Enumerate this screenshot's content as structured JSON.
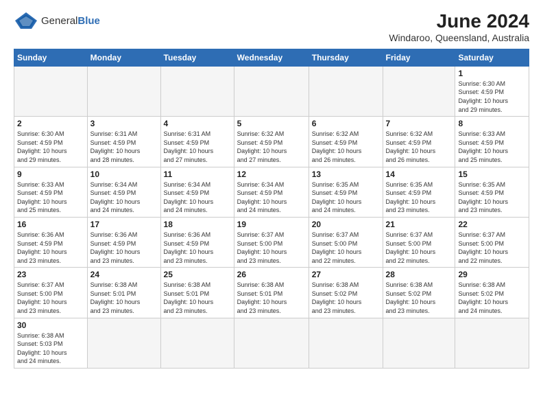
{
  "logo": {
    "text_general": "General",
    "text_blue": "Blue"
  },
  "title": "June 2024",
  "location": "Windaroo, Queensland, Australia",
  "weekdays": [
    "Sunday",
    "Monday",
    "Tuesday",
    "Wednesday",
    "Thursday",
    "Friday",
    "Saturday"
  ],
  "weeks": [
    [
      {
        "day": "",
        "info": ""
      },
      {
        "day": "",
        "info": ""
      },
      {
        "day": "",
        "info": ""
      },
      {
        "day": "",
        "info": ""
      },
      {
        "day": "",
        "info": ""
      },
      {
        "day": "",
        "info": ""
      },
      {
        "day": "1",
        "info": "Sunrise: 6:30 AM\nSunset: 4:59 PM\nDaylight: 10 hours\nand 29 minutes."
      }
    ],
    [
      {
        "day": "2",
        "info": "Sunrise: 6:30 AM\nSunset: 4:59 PM\nDaylight: 10 hours\nand 29 minutes."
      },
      {
        "day": "3",
        "info": "Sunrise: 6:31 AM\nSunset: 4:59 PM\nDaylight: 10 hours\nand 28 minutes."
      },
      {
        "day": "4",
        "info": "Sunrise: 6:31 AM\nSunset: 4:59 PM\nDaylight: 10 hours\nand 27 minutes."
      },
      {
        "day": "5",
        "info": "Sunrise: 6:32 AM\nSunset: 4:59 PM\nDaylight: 10 hours\nand 27 minutes."
      },
      {
        "day": "6",
        "info": "Sunrise: 6:32 AM\nSunset: 4:59 PM\nDaylight: 10 hours\nand 26 minutes."
      },
      {
        "day": "7",
        "info": "Sunrise: 6:32 AM\nSunset: 4:59 PM\nDaylight: 10 hours\nand 26 minutes."
      },
      {
        "day": "8",
        "info": "Sunrise: 6:33 AM\nSunset: 4:59 PM\nDaylight: 10 hours\nand 25 minutes."
      }
    ],
    [
      {
        "day": "9",
        "info": "Sunrise: 6:33 AM\nSunset: 4:59 PM\nDaylight: 10 hours\nand 25 minutes."
      },
      {
        "day": "10",
        "info": "Sunrise: 6:34 AM\nSunset: 4:59 PM\nDaylight: 10 hours\nand 24 minutes."
      },
      {
        "day": "11",
        "info": "Sunrise: 6:34 AM\nSunset: 4:59 PM\nDaylight: 10 hours\nand 24 minutes."
      },
      {
        "day": "12",
        "info": "Sunrise: 6:34 AM\nSunset: 4:59 PM\nDaylight: 10 hours\nand 24 minutes."
      },
      {
        "day": "13",
        "info": "Sunrise: 6:35 AM\nSunset: 4:59 PM\nDaylight: 10 hours\nand 24 minutes."
      },
      {
        "day": "14",
        "info": "Sunrise: 6:35 AM\nSunset: 4:59 PM\nDaylight: 10 hours\nand 23 minutes."
      },
      {
        "day": "15",
        "info": "Sunrise: 6:35 AM\nSunset: 4:59 PM\nDaylight: 10 hours\nand 23 minutes."
      }
    ],
    [
      {
        "day": "16",
        "info": "Sunrise: 6:36 AM\nSunset: 4:59 PM\nDaylight: 10 hours\nand 23 minutes."
      },
      {
        "day": "17",
        "info": "Sunrise: 6:36 AM\nSunset: 4:59 PM\nDaylight: 10 hours\nand 23 minutes."
      },
      {
        "day": "18",
        "info": "Sunrise: 6:36 AM\nSunset: 4:59 PM\nDaylight: 10 hours\nand 23 minutes."
      },
      {
        "day": "19",
        "info": "Sunrise: 6:37 AM\nSunset: 5:00 PM\nDaylight: 10 hours\nand 23 minutes."
      },
      {
        "day": "20",
        "info": "Sunrise: 6:37 AM\nSunset: 5:00 PM\nDaylight: 10 hours\nand 22 minutes."
      },
      {
        "day": "21",
        "info": "Sunrise: 6:37 AM\nSunset: 5:00 PM\nDaylight: 10 hours\nand 22 minutes."
      },
      {
        "day": "22",
        "info": "Sunrise: 6:37 AM\nSunset: 5:00 PM\nDaylight: 10 hours\nand 22 minutes."
      }
    ],
    [
      {
        "day": "23",
        "info": "Sunrise: 6:37 AM\nSunset: 5:00 PM\nDaylight: 10 hours\nand 23 minutes."
      },
      {
        "day": "24",
        "info": "Sunrise: 6:38 AM\nSunset: 5:01 PM\nDaylight: 10 hours\nand 23 minutes."
      },
      {
        "day": "25",
        "info": "Sunrise: 6:38 AM\nSunset: 5:01 PM\nDaylight: 10 hours\nand 23 minutes."
      },
      {
        "day": "26",
        "info": "Sunrise: 6:38 AM\nSunset: 5:01 PM\nDaylight: 10 hours\nand 23 minutes."
      },
      {
        "day": "27",
        "info": "Sunrise: 6:38 AM\nSunset: 5:02 PM\nDaylight: 10 hours\nand 23 minutes."
      },
      {
        "day": "28",
        "info": "Sunrise: 6:38 AM\nSunset: 5:02 PM\nDaylight: 10 hours\nand 23 minutes."
      },
      {
        "day": "29",
        "info": "Sunrise: 6:38 AM\nSunset: 5:02 PM\nDaylight: 10 hours\nand 24 minutes."
      }
    ],
    [
      {
        "day": "30",
        "info": "Sunrise: 6:38 AM\nSunset: 5:03 PM\nDaylight: 10 hours\nand 24 minutes."
      },
      {
        "day": "",
        "info": ""
      },
      {
        "day": "",
        "info": ""
      },
      {
        "day": "",
        "info": ""
      },
      {
        "day": "",
        "info": ""
      },
      {
        "day": "",
        "info": ""
      },
      {
        "day": "",
        "info": ""
      }
    ]
  ]
}
